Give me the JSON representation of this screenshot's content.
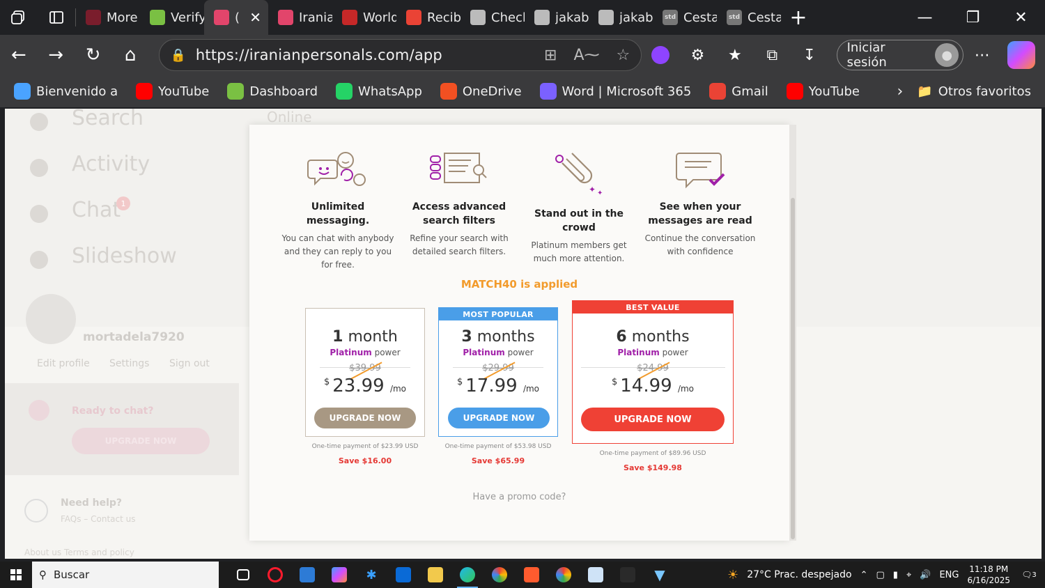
{
  "browser": {
    "tabs": [
      {
        "label": "More",
        "icon": "heart-tab-icon",
        "color": "#7a1d2c"
      },
      {
        "label": "Verify",
        "icon": "checkmark-link-icon",
        "color": "#7ac043"
      },
      {
        "label": "(",
        "icon": "heart-outline-icon",
        "color": "#e2456b",
        "active": true
      },
      {
        "label": "Irania",
        "icon": "heart-outline-icon",
        "color": "#e2456b"
      },
      {
        "label": "World",
        "icon": "globe-red-icon",
        "color": "#c62828"
      },
      {
        "label": "Recib",
        "icon": "gmail-icon",
        "color": "#ea4335"
      },
      {
        "label": "Check",
        "icon": "globe-icon",
        "color": "#bbbbbb"
      },
      {
        "label": "jakab",
        "icon": "document-icon",
        "color": "#bbbbbb"
      },
      {
        "label": "jakab",
        "icon": "document-icon",
        "color": "#bbbbbb"
      },
      {
        "label": "Cesta",
        "icon": "std-icon",
        "color": "#777777"
      },
      {
        "label": "Cesta",
        "icon": "std-icon",
        "color": "#777777"
      }
    ],
    "std_text": "std",
    "url": "https://iranianpersonals.com/app",
    "signin_label": "Iniciar sesión",
    "favorites": [
      {
        "label": "Bienvenido a",
        "icon": "edge-bubble-icon",
        "color": "#4aa3ff"
      },
      {
        "label": "YouTube",
        "icon": "youtube-icon",
        "color": "#ff0000"
      },
      {
        "label": "Dashboard",
        "icon": "checkmark-link-icon",
        "color": "#7ac043"
      },
      {
        "label": "WhatsApp",
        "icon": "whatsapp-icon",
        "color": "#25d366"
      },
      {
        "label": "OneDrive",
        "icon": "microsoft-icon",
        "color": "#f25022"
      },
      {
        "label": "Word | Microsoft 365",
        "icon": "m365-icon",
        "color": "#7b61ff"
      },
      {
        "label": "Gmail",
        "icon": "gmail-icon",
        "color": "#ea4335"
      },
      {
        "label": "YouTube",
        "icon": "youtube-icon",
        "color": "#ff0000"
      }
    ],
    "other_favorites": "Otros favoritos"
  },
  "page": {
    "sidebar": {
      "search": "Search",
      "activity": "Activity",
      "chat": "Chat",
      "chat_badge": "1",
      "slideshow": "Slideshow",
      "username": "mortadela7920",
      "edit_profile": "Edit profile",
      "settings": "Settings",
      "sign_out": "Sign out",
      "ready": "Ready to chat?",
      "upgrade": "UPGRADE NOW",
      "need_help": "Need help?",
      "faq": "FAQs – Contact us",
      "footer": "About us   Terms and policy"
    },
    "online": "Online"
  },
  "modal": {
    "features": [
      {
        "title": "Unlimited messaging.",
        "desc": "You can chat with anybody and they can reply to you for free.",
        "icon": "chat-faces-icon"
      },
      {
        "title": "Access advanced search filters",
        "desc": "Refine your search with detailed search filters.",
        "icon": "search-filters-icon"
      },
      {
        "title": "Stand out in the crowd",
        "desc": "Platinum members get much more attention.",
        "icon": "magnet-icon"
      },
      {
        "title": "See when your messages are read",
        "desc": "Continue the conversation with confidence",
        "icon": "message-read-icon"
      }
    ],
    "promo_applied": "MATCH40 is applied",
    "plans": [
      {
        "badge": "",
        "months_num": "1",
        "months_word": "month",
        "tier": "Platinum",
        "tier_suffix": "power",
        "old_price": "$39.99",
        "currency": "$",
        "price": "23.99",
        "per": "/mo",
        "button": "UPGRADE NOW",
        "payment": "One-time payment of $23.99 USD",
        "save": "Save $16.00",
        "button_color": "#a89883"
      },
      {
        "badge": "MOST POPULAR",
        "months_num": "3",
        "months_word": "months",
        "tier": "Platinum",
        "tier_suffix": "power",
        "old_price": "$29.99",
        "currency": "$",
        "price": "17.99",
        "per": "/mo",
        "button": "UPGRADE NOW",
        "payment": "One-time payment of $53.98 USD",
        "save": "Save $65.99",
        "button_color": "#4a9ee8"
      },
      {
        "badge": "BEST VALUE",
        "months_num": "6",
        "months_word": "months",
        "tier": "Platinum",
        "tier_suffix": "power",
        "old_price": "$24.99",
        "currency": "$",
        "price": "14.99",
        "per": "/mo",
        "button": "UPGRADE NOW",
        "payment": "One-time payment of $89.96 USD",
        "save": "Save $149.98",
        "button_color": "#ef4135"
      }
    ],
    "have_promo": "Have a promo code?"
  },
  "taskbar": {
    "search_placeholder": "Buscar",
    "weather": "27°C  Prac. despejado",
    "language": "ENG",
    "time": "11:18 PM",
    "date": "6/16/2025",
    "notifications": "3"
  }
}
